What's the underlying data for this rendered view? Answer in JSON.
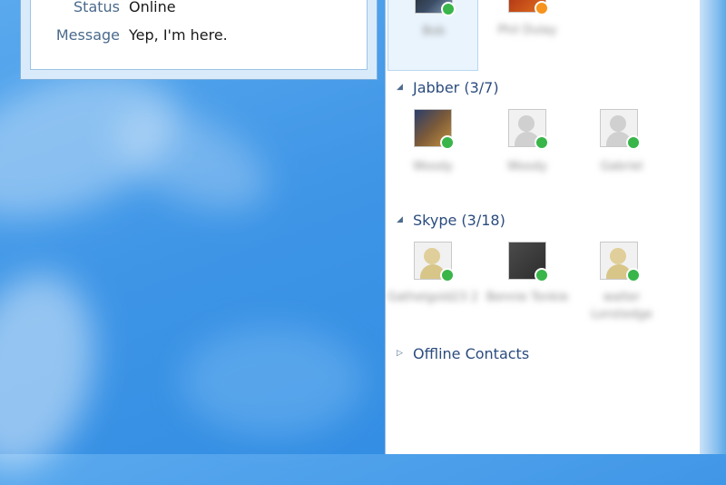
{
  "info": {
    "status_label": "Status",
    "status_value": "Online",
    "message_label": "Message",
    "message_value": "Yep, I'm here."
  },
  "top_contacts": [
    {
      "name": "Bob",
      "status": "online"
    },
    {
      "name": "Phil Dulay",
      "status": "away"
    }
  ],
  "groups": {
    "jabber": {
      "label": "Jabber (3/7)",
      "contacts": [
        {
          "name": "Woody"
        },
        {
          "name": "Woody"
        },
        {
          "name": "Gabriel"
        }
      ]
    },
    "skype": {
      "label": "Skype (3/18)",
      "contacts": [
        {
          "name": "Gathelgold23 2"
        },
        {
          "name": "Bennie Tonkie"
        },
        {
          "name": "walter Lonstedge"
        }
      ]
    },
    "offline": {
      "label": "Offline Contacts"
    }
  },
  "colors": {
    "online": "#39b54a",
    "away": "#f7941d",
    "group_header": "#2b4c7e",
    "desktop_blue": "#3e95e6"
  },
  "icons": {
    "expanded": "triangle-down-icon",
    "collapsed": "triangle-right-icon"
  }
}
